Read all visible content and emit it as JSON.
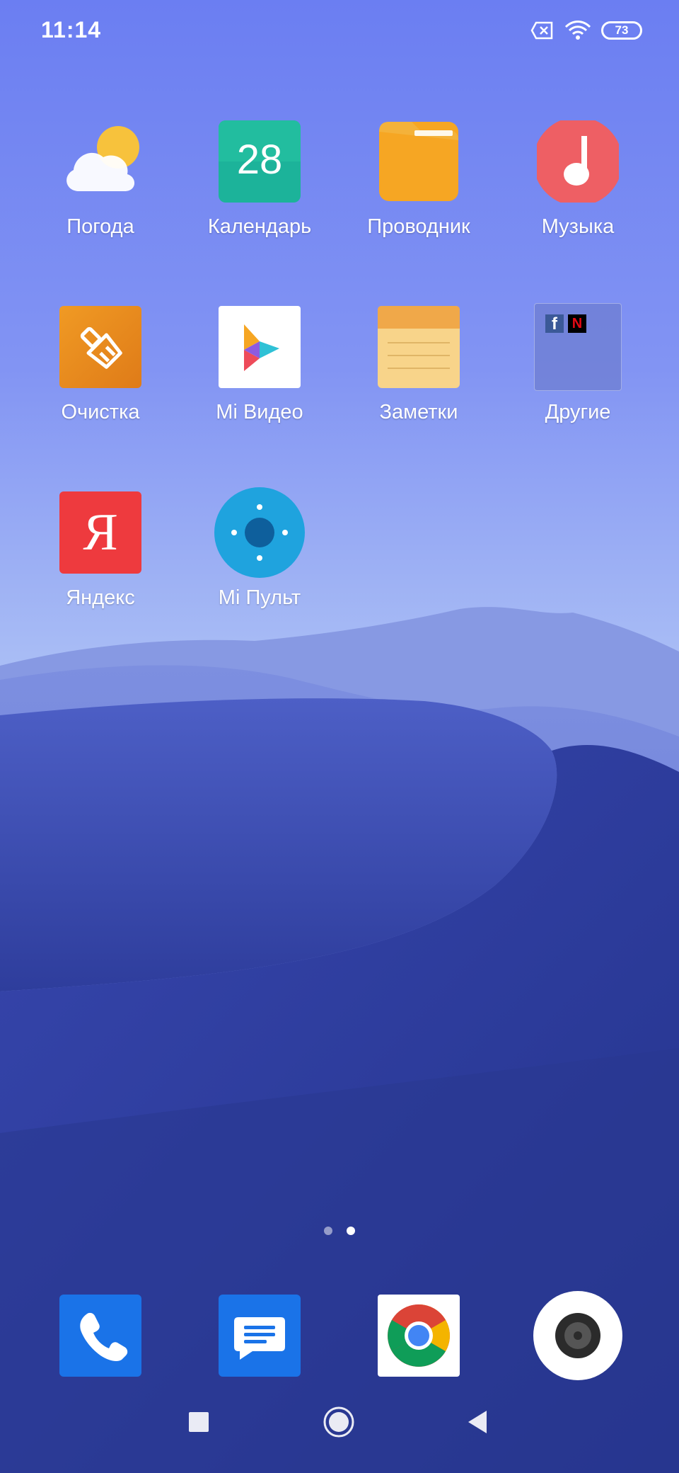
{
  "status_bar": {
    "time": "11:14",
    "battery_level": "73",
    "icons": [
      "sim-missing-icon",
      "wifi-icon",
      "battery-icon"
    ]
  },
  "apps": [
    {
      "label": "Погода",
      "icon": "weather-icon"
    },
    {
      "label": "Календарь",
      "icon": "calendar-icon",
      "day": "28"
    },
    {
      "label": "Проводник",
      "icon": "folder-icon"
    },
    {
      "label": "Музыка",
      "icon": "music-icon"
    },
    {
      "label": "Очистка",
      "icon": "cleaner-icon"
    },
    {
      "label": "Mi Видео",
      "icon": "video-play-icon"
    },
    {
      "label": "Заметки",
      "icon": "notes-icon"
    },
    {
      "label": "Другие",
      "icon": "folder-group-icon",
      "badges": [
        "f",
        "N"
      ]
    },
    {
      "label": "Яндекс",
      "icon": "yandex-icon",
      "glyph": "Я"
    },
    {
      "label": "Mi Пульт",
      "icon": "remote-icon"
    }
  ],
  "page_indicator": {
    "pages": 2,
    "current": 2
  },
  "dock": [
    {
      "icon": "phone-icon"
    },
    {
      "icon": "messages-icon"
    },
    {
      "icon": "chrome-icon"
    },
    {
      "icon": "camera-icon"
    }
  ],
  "nav_bar": {
    "buttons": [
      "recents-button",
      "home-button",
      "back-button"
    ]
  },
  "colors": {
    "sky_top": "#6c7ff2",
    "sky_bottom": "#a6b9f4",
    "dune_dark": "#2c3b98",
    "weather_sun": "#f7c23c",
    "calendar_bg": "#1cb39a",
    "folder": "#f6a623",
    "music": "#ee5f64",
    "cleaner": "#ec8e1e",
    "notes": "#f8d48a",
    "yandex": "#ee3a3e",
    "remote": "#1fa3de",
    "phone": "#1a73e8",
    "messages": "#1a73e8"
  }
}
